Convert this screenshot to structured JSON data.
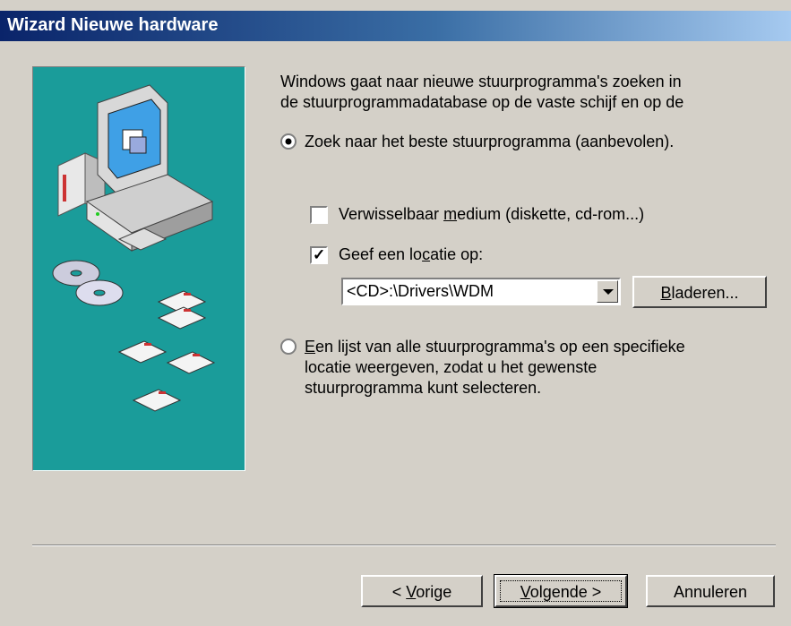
{
  "window": {
    "title": "Wizard Nieuwe hardware"
  },
  "intro": {
    "line1": "Windows gaat naar nieuwe stuurprogramma's zoeken in",
    "line2": "de stuurprogrammadatabase op de vaste schijf en op de"
  },
  "option_search": {
    "label": "Zoek naar het beste stuurprogramma (aanbevolen).",
    "selected": true
  },
  "check_removable": {
    "label_pre": "Verwisselbaar ",
    "label_ul": "m",
    "label_post": "edium (diskette, cd-rom...)",
    "checked": false
  },
  "check_location": {
    "label_pre": "Geef een lo",
    "label_ul": "c",
    "label_post": "atie op:",
    "checked": true
  },
  "location_combo": {
    "value": "<CD>:\\Drivers\\WDM"
  },
  "browse_button": {
    "label_ul": "B",
    "label_post": "laderen..."
  },
  "option_list": {
    "line1_ul": "E",
    "line1_post": "en lijst van alle stuurprogramma's op een specifieke",
    "line2": "locatie weergeven, zodat u het gewenste",
    "line3": "stuurprogramma kunt selecteren.",
    "selected": false
  },
  "buttons": {
    "back_pre": "< ",
    "back_ul": "V",
    "back_post": "orige",
    "next_ul": "V",
    "next_post": "olgende >",
    "cancel": "Annuleren"
  },
  "colors": {
    "title_start": "#0a246a",
    "title_end": "#a6caf0",
    "art_bg": "#1a9c9a",
    "dialog_bg": "#d4d0c8"
  }
}
